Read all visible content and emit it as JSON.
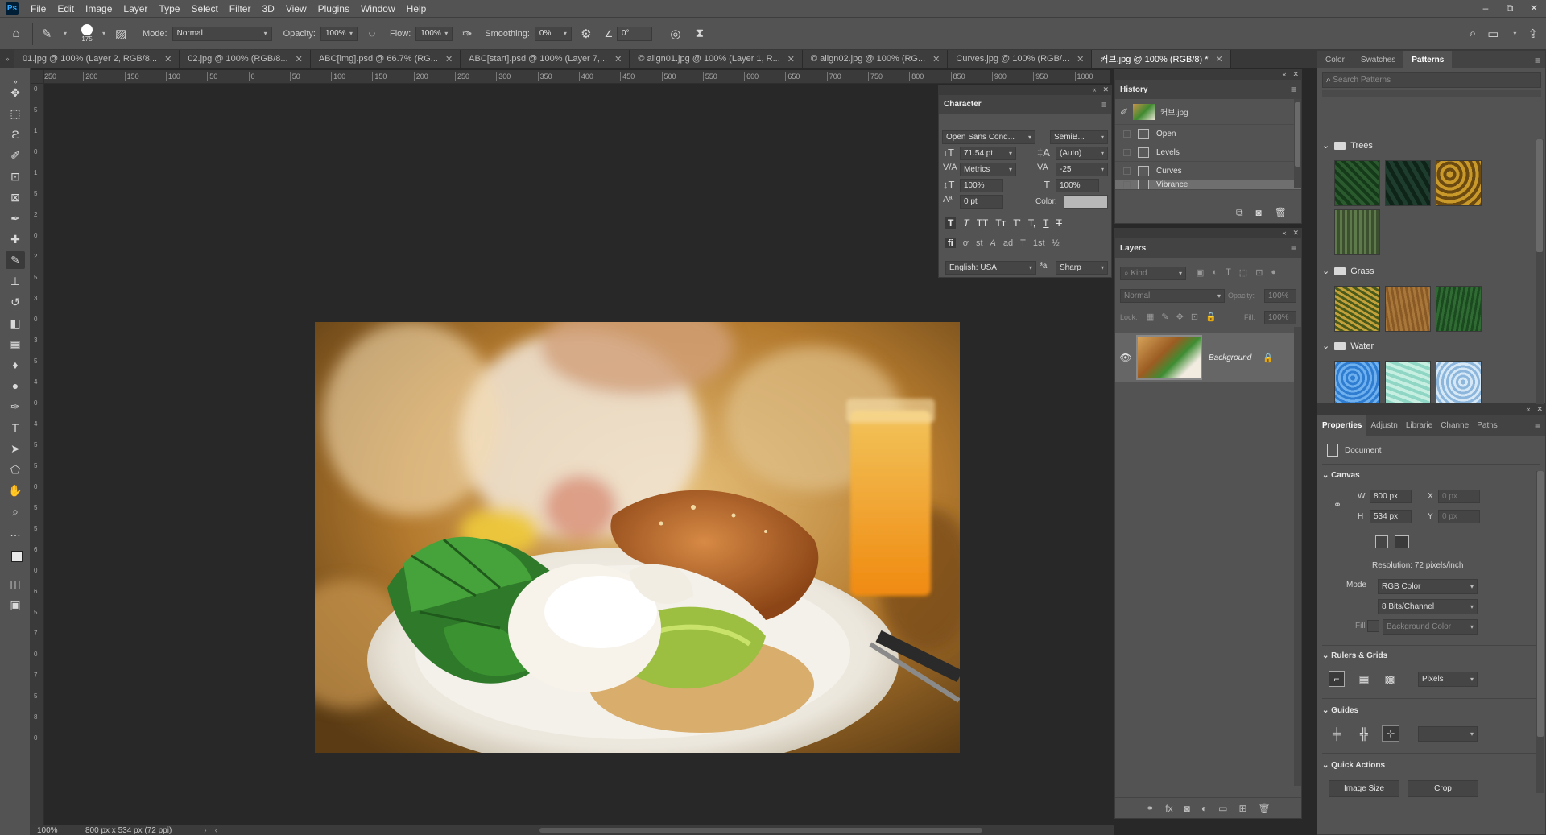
{
  "menubar": {
    "logo": "Ps",
    "items": [
      "File",
      "Edit",
      "Image",
      "Layer",
      "Type",
      "Select",
      "Filter",
      "3D",
      "View",
      "Plugins",
      "Window",
      "Help"
    ],
    "window_controls": [
      "–",
      "⧉",
      "✕"
    ]
  },
  "options": {
    "brush_size": "175",
    "mode_label": "Mode:",
    "mode_value": "Normal",
    "opacity_label": "Opacity:",
    "opacity_value": "100%",
    "flow_label": "Flow:",
    "flow_value": "100%",
    "smoothing_label": "Smoothing:",
    "smoothing_value": "0%",
    "angle_value": "0°"
  },
  "tabs": [
    {
      "label": "01.jpg @ 100% (Layer 2, RGB/8..."
    },
    {
      "label": "02.jpg @ 100% (RGB/8..."
    },
    {
      "label": "ABC[img].psd @ 66.7% (RG..."
    },
    {
      "label": "ABC[start].psd @ 100% (Layer 7,..."
    },
    {
      "label": "© align01.jpg @ 100% (Layer 1, R..."
    },
    {
      "label": "© align02.jpg @ 100% (RG..."
    },
    {
      "label": "Curves.jpg @ 100% (RGB/..."
    },
    {
      "label": "커브.jpg @ 100% (RGB/8) *"
    }
  ],
  "ruler_h": [
    "250",
    "200",
    "150",
    "100",
    "50",
    "0",
    "50",
    "100",
    "150",
    "200",
    "250",
    "300",
    "350",
    "400",
    "450",
    "500",
    "550",
    "600",
    "650",
    "700",
    "750",
    "800",
    "850",
    "900",
    "950",
    "1000"
  ],
  "ruler_v": [
    "0",
    "5",
    "1",
    "0",
    "1",
    "5",
    "2",
    "0",
    "2",
    "5",
    "3",
    "0",
    "3",
    "5",
    "4",
    "0",
    "4",
    "5",
    "5",
    "0",
    "5",
    "5",
    "6",
    "0",
    "6",
    "5",
    "7",
    "0",
    "7",
    "5",
    "8",
    "0"
  ],
  "status": {
    "zoom": "100%",
    "doc_info": "800 px x 534 px (72 ppi)"
  },
  "character": {
    "title": "Character",
    "font_family": "Open Sans Cond...",
    "font_style": "SemiB...",
    "size": "71.54 pt",
    "leading": "(Auto)",
    "kerning": "Metrics",
    "tracking": "-25",
    "vscale": "100%",
    "hscale": "100%",
    "baseline": "0 pt",
    "color_label": "Color:",
    "language": "English: USA",
    "aa_label": "ªa",
    "antialias": "Sharp",
    "style_buttons": [
      "T",
      "T",
      "TT",
      "Tт",
      "T'",
      "T,",
      "T",
      "T"
    ],
    "ot_buttons": [
      "fi",
      "ơ",
      "st",
      "A",
      "ad",
      "T",
      "1st",
      "½"
    ]
  },
  "history": {
    "title": "History",
    "snapshot": "커브.jpg",
    "items": [
      "Open",
      "Levels",
      "Curves",
      "Vibrance"
    ],
    "selected_index": 3
  },
  "layers": {
    "title": "Layers",
    "kind_placeholder": "Kind",
    "blend_mode": "Normal",
    "opacity_label": "Opacity:",
    "opacity_value": "100%",
    "lock_label": "Lock:",
    "fill_label": "Fill:",
    "fill_value": "100%",
    "layer_name": "Background"
  },
  "right_tabs": [
    "Color",
    "Swatches",
    "Patterns"
  ],
  "patterns": {
    "search_placeholder": "Search Patterns",
    "groups": [
      {
        "name": "Trees",
        "swatches": [
          "#2a5a2e",
          "#1e3d2e",
          "#c99a2a",
          "#5f7a4a"
        ]
      },
      {
        "name": "Grass",
        "swatches": [
          "#c2a13a",
          "#a8773a",
          "#2f6b33"
        ]
      },
      {
        "name": "Water",
        "swatches": [
          "#2e7dd0",
          "#8fd6c4",
          "#8cb6dc"
        ]
      }
    ]
  },
  "properties": {
    "tabs": [
      "Properties",
      "Adjustn",
      "Librarie",
      "Channe",
      "Paths"
    ],
    "doc_label": "Document",
    "canvas_label": "Canvas",
    "w_label": "W",
    "w_value": "800 px",
    "h_label": "H",
    "h_value": "534 px",
    "x_label": "X",
    "x_value": "0 px",
    "y_label": "Y",
    "y_value": "0 px",
    "resolution": "Resolution: 72 pixels/inch",
    "mode_label": "Mode",
    "mode_value": "RGB Color",
    "bits_value": "8 Bits/Channel",
    "fill_label": "Fill",
    "fill_value": "Background Color",
    "rulers_label": "Rulers & Grids",
    "units_value": "Pixels",
    "guides_label": "Guides",
    "quick_label": "Quick Actions",
    "image_size_btn": "Image Size",
    "crop_btn": "Crop"
  },
  "colors": {
    "bg": "#282828",
    "panel": "#535353",
    "accent": "#31a8ff"
  }
}
